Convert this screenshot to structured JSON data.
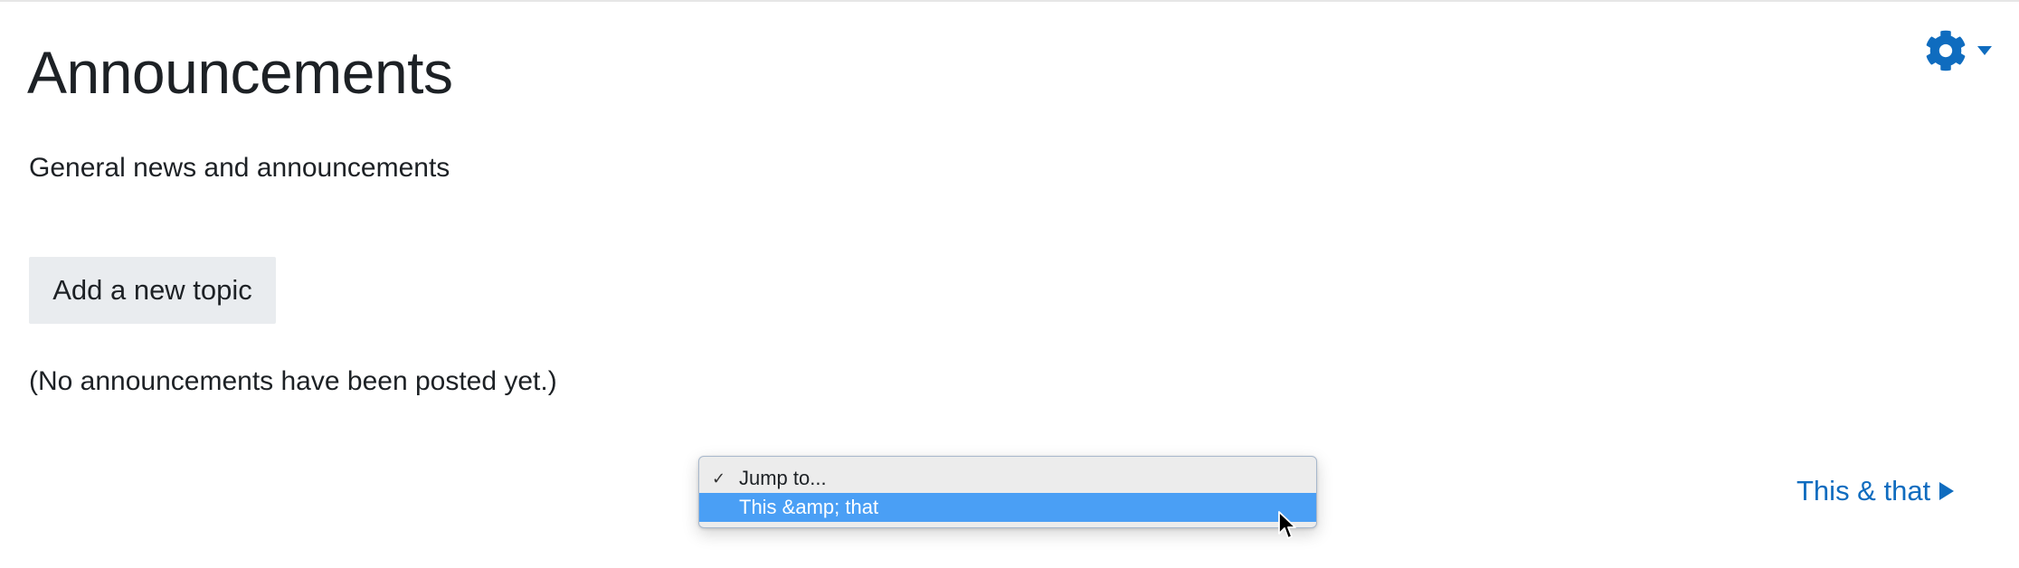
{
  "page": {
    "title": "Announcements",
    "intro": "General news and announcements",
    "add_topic_label": "Add a new topic",
    "empty_message": "(No announcements have been posted yet.)"
  },
  "settings": {
    "icon": "gear-icon",
    "caret_icon": "caret-down-icon",
    "accent_color": "#0f6cbf"
  },
  "activity_navigation": {
    "jump_select": {
      "options": [
        {
          "label": "Jump to...",
          "checked": true
        },
        {
          "label": "This &amp; that",
          "highlighted": true
        }
      ],
      "highlight_color": "#4a9ff5"
    },
    "next_link": {
      "label": "This & that",
      "icon": "play-arrow-icon"
    }
  }
}
